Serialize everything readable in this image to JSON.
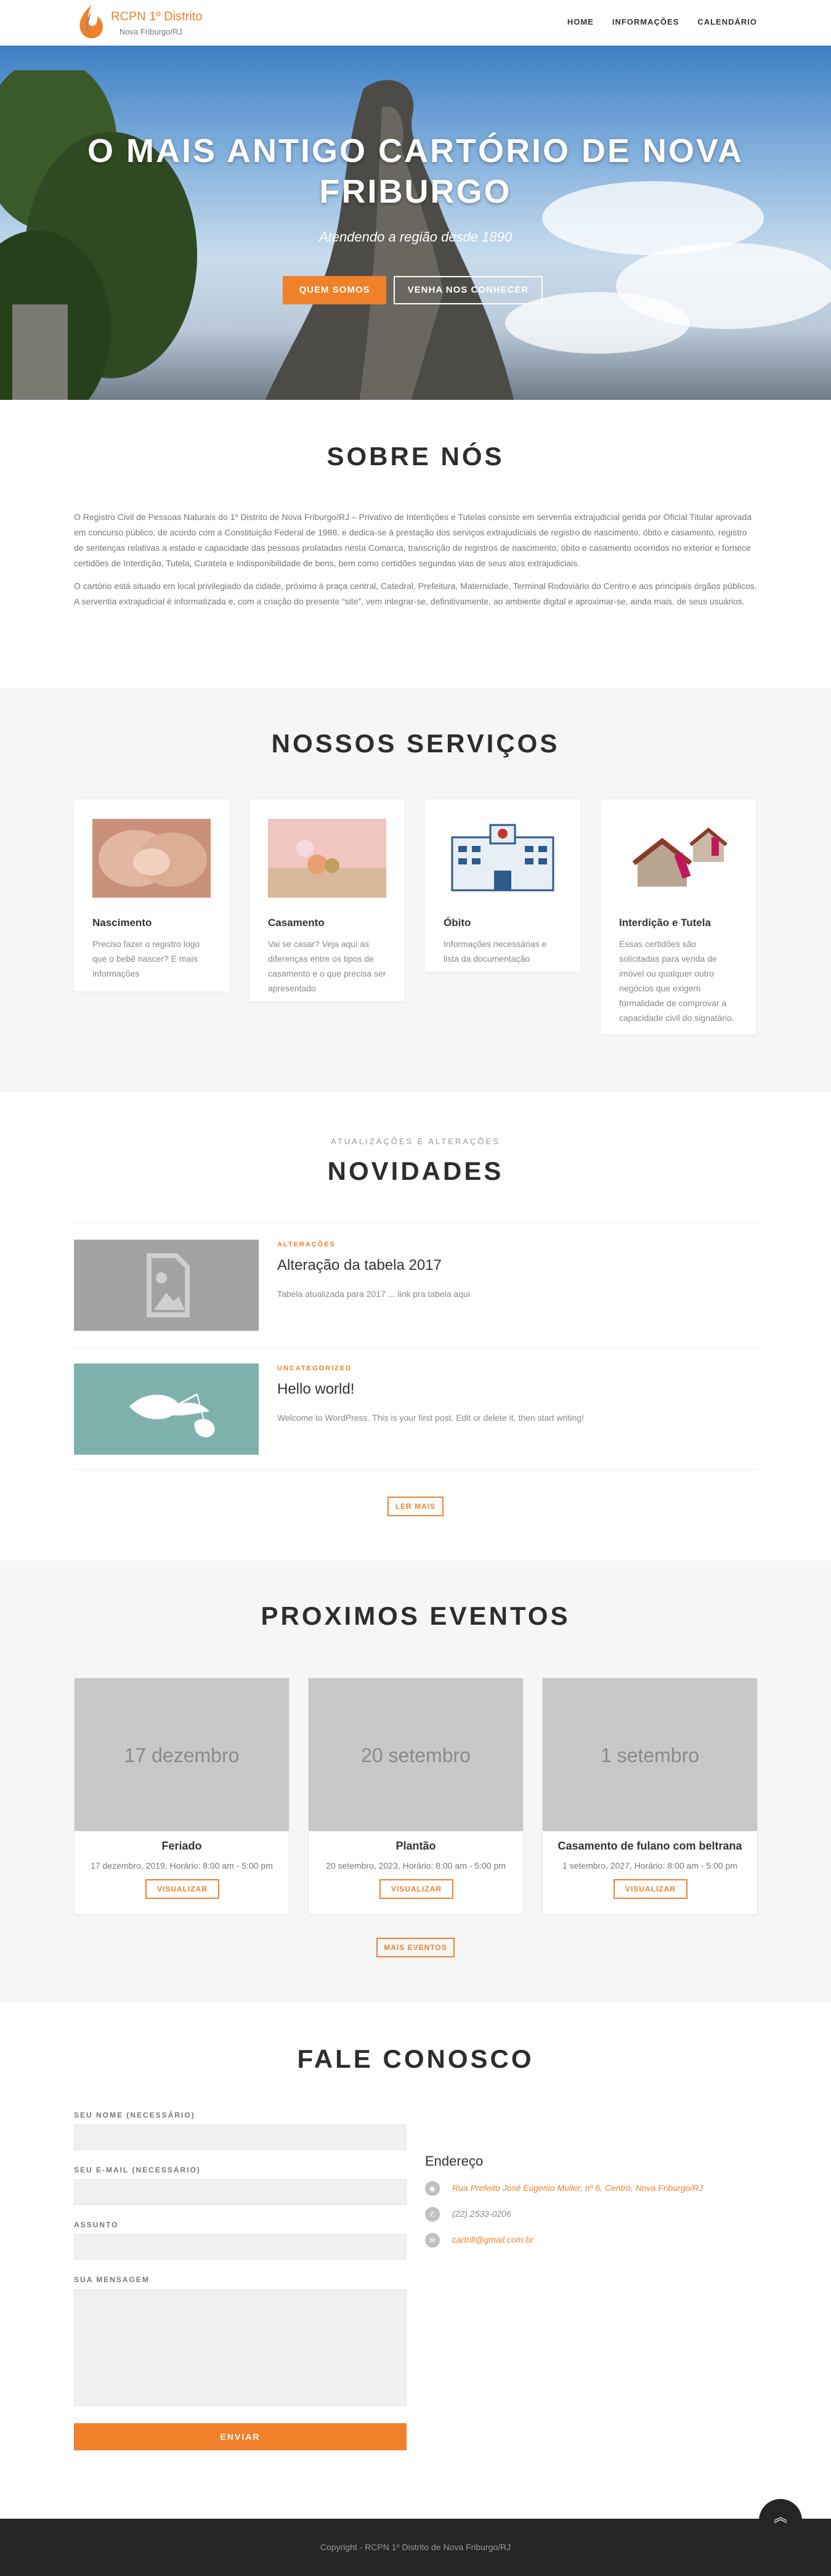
{
  "header": {
    "logo_title": "RCPN 1º Distrito",
    "logo_sub": "Nova Friburgo/RJ",
    "nav": [
      "HOME",
      "INFORMAÇÕES",
      "CALENDÁRIO"
    ]
  },
  "hero": {
    "title": "O MAIS ANTIGO CARTÓRIO DE NOVA FRIBURGO",
    "subtitle": "Atendendo a região desde 1890",
    "btn1": "QUEM SOMOS",
    "btn2": "VENHA NOS CONHECER"
  },
  "about": {
    "title": "SOBRE NÓS",
    "p1": "O Registro Civil de Pessoas Naturais do 1º Distrito de Nova Friburgo/RJ – Privativo de Interdições e Tutelas consiste em serventia extrajudicial gerida por Oficial Titular aprovada em concurso público, de acordo com a Constituição Federal de 1988, e dedica-se à prestação dos serviços extrajudiciais de registro de nascimento, óbito e casamento, registro de sentenças relativas a estado e capacidade das pessoas prolatadas nesta Comarca, transcrição de registros de nascimento, óbito e casamento ocorridos no exterior e fornece certidões de Interdição, Tutela, Curatela e Indisponibilidade de bens, bem como certidões segundas vias de seus atos extrajudiciais.",
    "p2": "O cartório está situado em local privilegiado da cidade, próximo à praça central, Catedral, Prefeitura, Maternidade, Terminal Rodoviário do Centro e aos principais órgãos públicos.",
    "p3": "A serventia extrajudicial é informatizada e, com a criação do presente “site”, vem integrar-se, definitivamente, ao ambiente digital e aproximar-se, ainda mais, de seus usuários."
  },
  "services": {
    "title": "NOSSOS SERVIÇOS",
    "items": [
      {
        "title": "Nascimento",
        "text": "Preciso fazer o registro logo que o bebê nascer? E mais informações",
        "icon": "baby-feet-icon"
      },
      {
        "title": "Casamento",
        "text": "Vai se casar? Veja aqui as diferenças entre os tipos de casamento e o que precisa ser apresentado",
        "icon": "wedding-icon"
      },
      {
        "title": "Óbito",
        "text": "Informações necessárias e lista da documentação",
        "icon": "hospital-icon"
      },
      {
        "title": "Interdição e Tutela",
        "text": "Essas certidões são solicitadas para venda de imóvel ou qualquer outro negócios que exigem formalidade de comprovar a capacidade civil do signatário.",
        "icon": "houses-sale-icon"
      }
    ]
  },
  "news": {
    "kicker": "ATUALIZAÇÕES E ALTERAÇÕES",
    "title": "NOVIDADES",
    "more": "LER MAIS",
    "posts": [
      {
        "cat": "ALTERAÇÕES",
        "title": "Alteração da tabela 2017",
        "excerpt": "Tabela atualizada para 2017 ... link pra tabela aqui"
      },
      {
        "cat": "UNCATEGORIZED",
        "title": "Hello world!",
        "excerpt": "Welcome to WordPress. This is your first post. Edit or delete it, then start writing!"
      }
    ]
  },
  "events": {
    "title": "PROXIMOS EVENTOS",
    "more": "MAIS EVENTOS",
    "view": "VISUALIZAR",
    "items": [
      {
        "img": "17 dezembro",
        "title": "Feriado",
        "date": "17 dezembro, 2019, Horário: 8:00 am - 5:00 pm"
      },
      {
        "img": "20 setembro",
        "title": "Plantão",
        "date": "20 setembro, 2023, Horário: 8:00 am - 5:00 pm"
      },
      {
        "img": "1 setembro",
        "title": "Casamento de fulano com beltrana",
        "date": "1 setembro, 2027, Horário: 8:00 am - 5:00 pm"
      }
    ]
  },
  "contact": {
    "title": "FALE CONOSCO",
    "name": "SEU NOME (NECESSÁRIO)",
    "email": "SEU E-MAIL (NECESSÁRIO)",
    "subject": "ASSUNTO",
    "message": "SUA MENSAGEM",
    "send": "ENVIAR",
    "addr_title": "Endereço",
    "address": "Rua Prefeito José Eugenio Muller, nº 6, Centro, Nova Friburgo/RJ",
    "phone": "(22) 2533-0206",
    "mail": "cartrill@gmail.com.br"
  },
  "footer": {
    "copy": "Copyright - RCPN 1º Distrito de Nova Friburgo/RJ"
  },
  "colors": {
    "accent": "#f0812a",
    "dark": "#252525"
  }
}
